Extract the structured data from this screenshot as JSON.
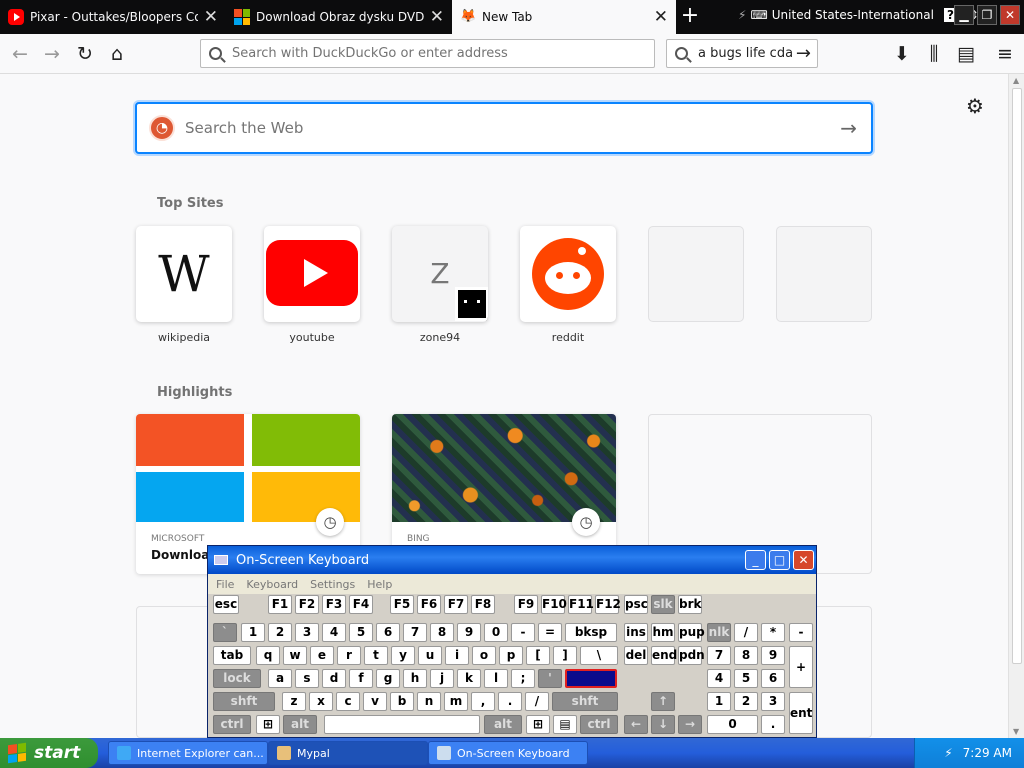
{
  "tabs": [
    {
      "title": "Pixar - Outtakes/Bloopers Collectic",
      "icon": "youtube-icon"
    },
    {
      "title": "Download Obraz dysku DVD w form",
      "icon": "microsoft-icon"
    },
    {
      "title": "New Tab",
      "icon": "firefox-icon"
    }
  ],
  "tray_top": {
    "keyboard_layout": "United States-International",
    "help": "?"
  },
  "navbar": {
    "url_placeholder": "Search with DuckDuckGo or enter address",
    "search_value": "a bugs life cda"
  },
  "newtab": {
    "search_placeholder": "Search the Web",
    "top_sites_heading": "Top Sites",
    "highlights_heading": "Highlights",
    "top_sites": [
      {
        "label": "wikipedia"
      },
      {
        "label": "youtube"
      },
      {
        "label": "zone94",
        "letter": "Z"
      },
      {
        "label": "reddit"
      }
    ],
    "highlights": [
      {
        "source": "MICROSOFT",
        "title": "Download"
      },
      {
        "source": "BING",
        "title": ""
      }
    ]
  },
  "osk": {
    "title": "On-Screen Keyboard",
    "menu": [
      "File",
      "Keyboard",
      "Settings",
      "Help"
    ]
  },
  "taskbar": {
    "start": "start",
    "tasks": [
      "Internet Explorer can...",
      "Mypal",
      "On-Screen Keyboard"
    ],
    "clock": "7:29 AM"
  }
}
